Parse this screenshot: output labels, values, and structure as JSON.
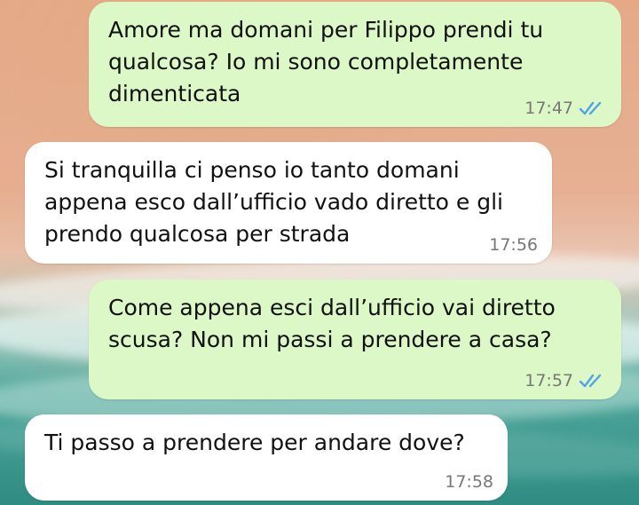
{
  "messages": [
    {
      "direction": "outgoing",
      "text": "Amore ma domani per Filippo prendi tu\nqualcosa? Io mi sono completamente\ndimenticata",
      "time": "17:47",
      "status_icon": "double-check-read-icon"
    },
    {
      "direction": "incoming",
      "text": "Si tranquilla ci penso io tanto domani\nappena esco dall’ufficio vado diretto e gli\nprendo qualcosa per strada",
      "time": "17:56"
    },
    {
      "direction": "outgoing",
      "text": "Come appena esci dall’ufficio vai diretto\nscusa? Non mi passi a prendere a casa?",
      "time": "17:57",
      "status_icon": "double-check-read-icon"
    },
    {
      "direction": "incoming",
      "text": "Ti passo a prendere per andare dove?",
      "time": "17:58"
    }
  ],
  "colors": {
    "outgoing_bubble": "#dcf8c6",
    "incoming_bubble": "#ffffff",
    "read_ticks": "#4fa3e8",
    "timestamp": "#777777"
  }
}
